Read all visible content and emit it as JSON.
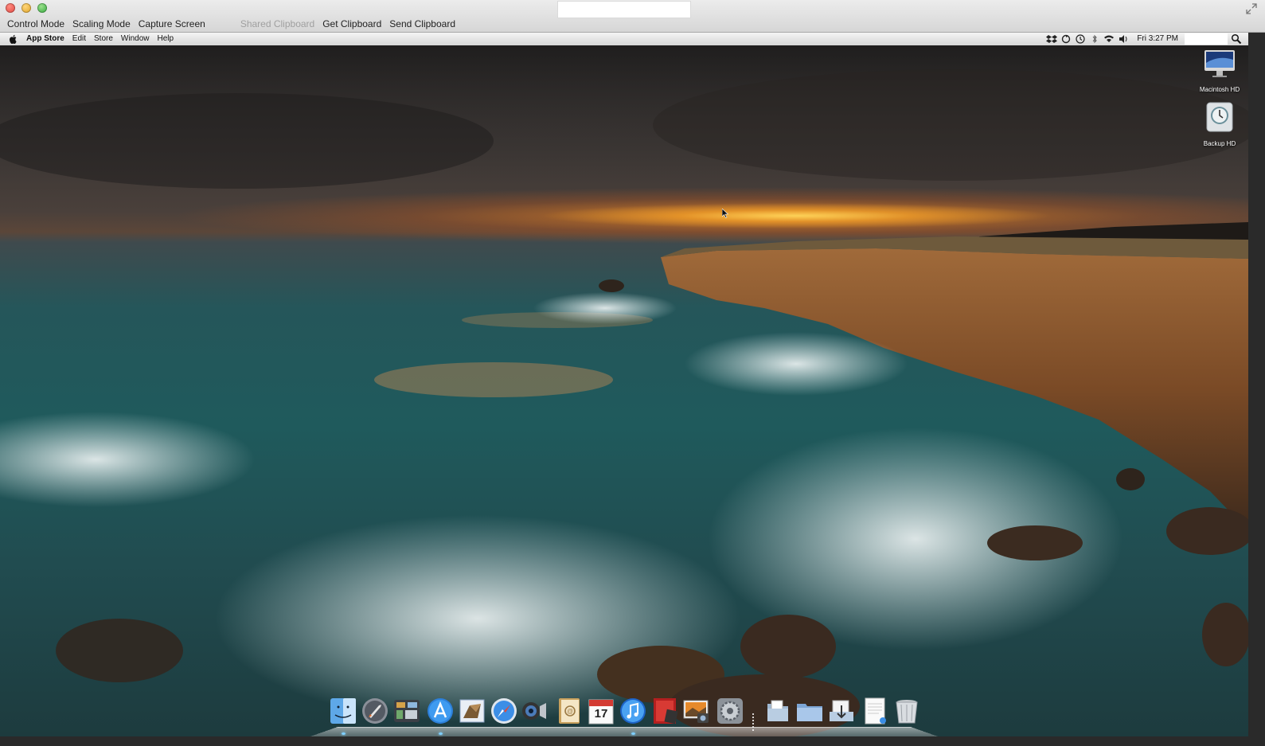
{
  "viewer": {
    "toolbar": {
      "control_mode": "Control Mode",
      "scaling_mode": "Scaling Mode",
      "capture_screen": "Capture Screen",
      "shared_clipboard": "Shared Clipboard",
      "get_clipboard": "Get Clipboard",
      "send_clipboard": "Send Clipboard"
    }
  },
  "menubar": {
    "app_name": "App Store",
    "menus": [
      "Edit",
      "Store",
      "Window",
      "Help"
    ],
    "clock": "Fri 3:27 PM",
    "status_icons": [
      "dropbox-icon",
      "sync-icon",
      "time-machine-icon",
      "bluetooth-icon",
      "wifi-icon",
      "volume-icon"
    ]
  },
  "desktop": {
    "icons": [
      {
        "label": "Macintosh HD",
        "icon": "imac-icon"
      },
      {
        "label": "Backup HD",
        "icon": "time-machine-drive-icon"
      }
    ]
  },
  "dock": {
    "apps": [
      "finder-icon",
      "launchpad-icon",
      "mission-control-icon",
      "app-store-icon",
      "mail-icon",
      "safari-icon",
      "facetime-icon",
      "contacts-icon",
      "calendar-icon",
      "itunes-icon",
      "photo-booth-icon",
      "iphoto-icon",
      "system-preferences-icon"
    ],
    "calendar_day": "17",
    "stacks": [
      "documents-icon",
      "applications-folder-icon",
      "downloads-icon",
      "textedit-doc-icon",
      "trash-icon"
    ],
    "colors": {
      "accent": "#1e7ad6",
      "running_indicator": "#7fd0ff"
    }
  }
}
